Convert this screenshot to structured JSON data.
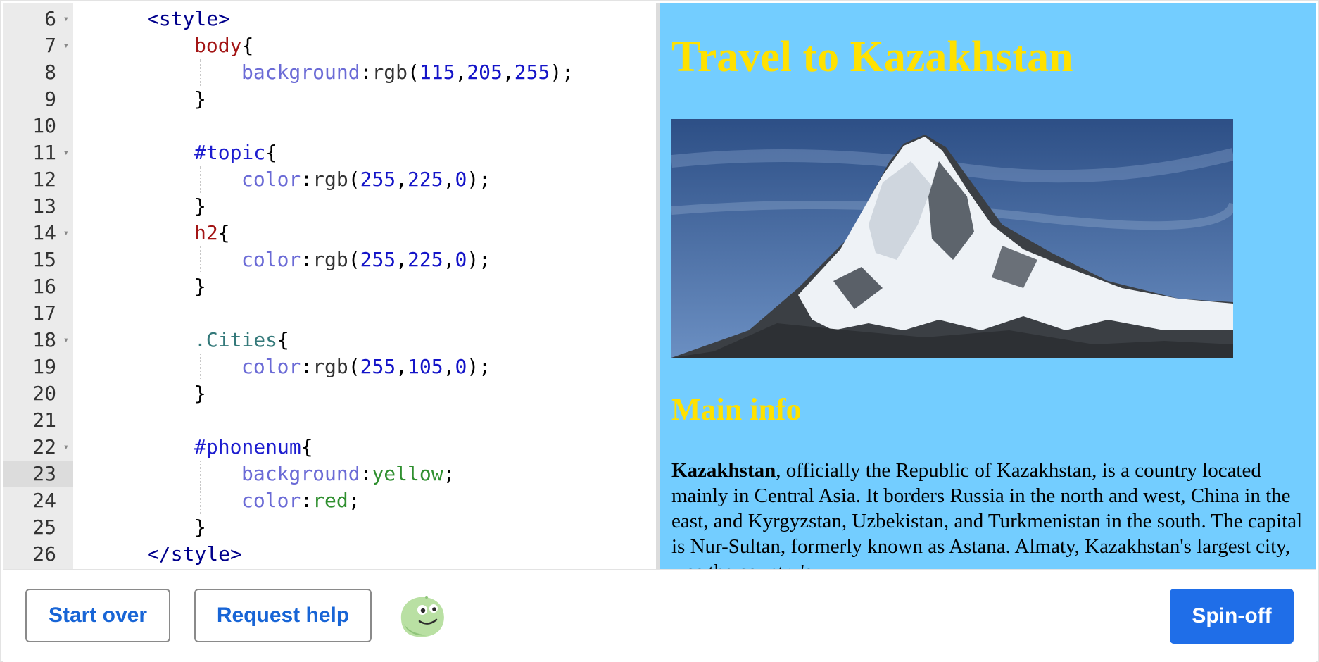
{
  "editor": {
    "active_line": "23",
    "lines": [
      {
        "n": "6",
        "fold": true,
        "tokens": [
          {
            "t": "<style>",
            "c": "t-tag"
          }
        ],
        "indent": 2
      },
      {
        "n": "7",
        "fold": true,
        "tokens": [
          {
            "t": "body",
            "c": "t-sel"
          },
          {
            "t": "{",
            "c": "t-pun"
          }
        ],
        "indent": 3
      },
      {
        "n": "8",
        "fold": false,
        "tokens": [
          {
            "t": "background",
            "c": "t-prop"
          },
          {
            "t": ":",
            "c": "t-pun"
          },
          {
            "t": "rgb",
            "c": "t-fn"
          },
          {
            "t": "(",
            "c": "t-pun"
          },
          {
            "t": "115",
            "c": "t-num"
          },
          {
            "t": ",",
            "c": "t-pun"
          },
          {
            "t": "205",
            "c": "t-num"
          },
          {
            "t": ",",
            "c": "t-pun"
          },
          {
            "t": "255",
            "c": "t-num"
          },
          {
            "t": ");",
            "c": "t-pun"
          }
        ],
        "indent": 4
      },
      {
        "n": "9",
        "fold": false,
        "tokens": [
          {
            "t": "}",
            "c": "t-pun"
          }
        ],
        "indent": 3
      },
      {
        "n": "10",
        "fold": false,
        "tokens": [],
        "indent": 3
      },
      {
        "n": "11",
        "fold": true,
        "tokens": [
          {
            "t": "#topic",
            "c": "t-id"
          },
          {
            "t": "{",
            "c": "t-pun"
          }
        ],
        "indent": 3
      },
      {
        "n": "12",
        "fold": false,
        "tokens": [
          {
            "t": "color",
            "c": "t-prop"
          },
          {
            "t": ":",
            "c": "t-pun"
          },
          {
            "t": "rgb",
            "c": "t-fn"
          },
          {
            "t": "(",
            "c": "t-pun"
          },
          {
            "t": "255",
            "c": "t-num"
          },
          {
            "t": ",",
            "c": "t-pun"
          },
          {
            "t": "225",
            "c": "t-num"
          },
          {
            "t": ",",
            "c": "t-pun"
          },
          {
            "t": "0",
            "c": "t-num"
          },
          {
            "t": ");",
            "c": "t-pun"
          }
        ],
        "indent": 4
      },
      {
        "n": "13",
        "fold": false,
        "tokens": [
          {
            "t": "}",
            "c": "t-pun"
          }
        ],
        "indent": 3
      },
      {
        "n": "14",
        "fold": true,
        "tokens": [
          {
            "t": "h2",
            "c": "t-sel"
          },
          {
            "t": "{",
            "c": "t-pun"
          }
        ],
        "indent": 3
      },
      {
        "n": "15",
        "fold": false,
        "tokens": [
          {
            "t": "color",
            "c": "t-prop"
          },
          {
            "t": ":",
            "c": "t-pun"
          },
          {
            "t": "rgb",
            "c": "t-fn"
          },
          {
            "t": "(",
            "c": "t-pun"
          },
          {
            "t": "255",
            "c": "t-num"
          },
          {
            "t": ",",
            "c": "t-pun"
          },
          {
            "t": "225",
            "c": "t-num"
          },
          {
            "t": ",",
            "c": "t-pun"
          },
          {
            "t": "0",
            "c": "t-num"
          },
          {
            "t": ");",
            "c": "t-pun"
          }
        ],
        "indent": 4
      },
      {
        "n": "16",
        "fold": false,
        "tokens": [
          {
            "t": "}",
            "c": "t-pun"
          }
        ],
        "indent": 3
      },
      {
        "n": "17",
        "fold": false,
        "tokens": [],
        "indent": 3
      },
      {
        "n": "18",
        "fold": true,
        "tokens": [
          {
            "t": ".Cities",
            "c": "t-cls"
          },
          {
            "t": "{",
            "c": "t-pun"
          }
        ],
        "indent": 3
      },
      {
        "n": "19",
        "fold": false,
        "tokens": [
          {
            "t": "color",
            "c": "t-prop"
          },
          {
            "t": ":",
            "c": "t-pun"
          },
          {
            "t": "rgb",
            "c": "t-fn"
          },
          {
            "t": "(",
            "c": "t-pun"
          },
          {
            "t": "255",
            "c": "t-num"
          },
          {
            "t": ",",
            "c": "t-pun"
          },
          {
            "t": "105",
            "c": "t-num"
          },
          {
            "t": ",",
            "c": "t-pun"
          },
          {
            "t": "0",
            "c": "t-num"
          },
          {
            "t": ");",
            "c": "t-pun"
          }
        ],
        "indent": 4
      },
      {
        "n": "20",
        "fold": false,
        "tokens": [
          {
            "t": "}",
            "c": "t-pun"
          }
        ],
        "indent": 3
      },
      {
        "n": "21",
        "fold": false,
        "tokens": [],
        "indent": 3
      },
      {
        "n": "22",
        "fold": true,
        "tokens": [
          {
            "t": "#phonenum",
            "c": "t-id"
          },
          {
            "t": "{",
            "c": "t-pun"
          }
        ],
        "indent": 3
      },
      {
        "n": "23",
        "fold": false,
        "tokens": [
          {
            "t": "background",
            "c": "t-prop"
          },
          {
            "t": ":",
            "c": "t-pun"
          },
          {
            "t": "yellow",
            "c": "t-kw"
          },
          {
            "t": ";",
            "c": "t-pun"
          }
        ],
        "indent": 4
      },
      {
        "n": "24",
        "fold": false,
        "tokens": [
          {
            "t": "color",
            "c": "t-prop"
          },
          {
            "t": ":",
            "c": "t-pun"
          },
          {
            "t": "red",
            "c": "t-kw"
          },
          {
            "t": ";",
            "c": "t-pun"
          }
        ],
        "indent": 4
      },
      {
        "n": "25",
        "fold": false,
        "tokens": [
          {
            "t": "}",
            "c": "t-pun"
          }
        ],
        "indent": 3
      },
      {
        "n": "26",
        "fold": false,
        "tokens": [
          {
            "t": "</style>",
            "c": "t-tag"
          }
        ],
        "indent": 2
      }
    ]
  },
  "preview": {
    "background": "#73cdff",
    "heading_color": "#ffe100",
    "title": "Travel to Kazakhstan",
    "subheading": "Main info",
    "para_bold": "Kazakhstan",
    "para_text": ", officially the Republic of Kazakhstan, is a country located mainly in Central Asia. It borders Russia in the north and west, China in the east, and Kyrgyzstan, Uzbekistan, and Turkmenistan in the south. The capital is Nur-Sultan, formerly known as Astana. Almaty, Kazakhstan's largest city, was the country's"
  },
  "toolbar": {
    "start_over": "Start over",
    "request_help": "Request help",
    "spin_off": "Spin-off",
    "accent": "#1f6ee8"
  }
}
